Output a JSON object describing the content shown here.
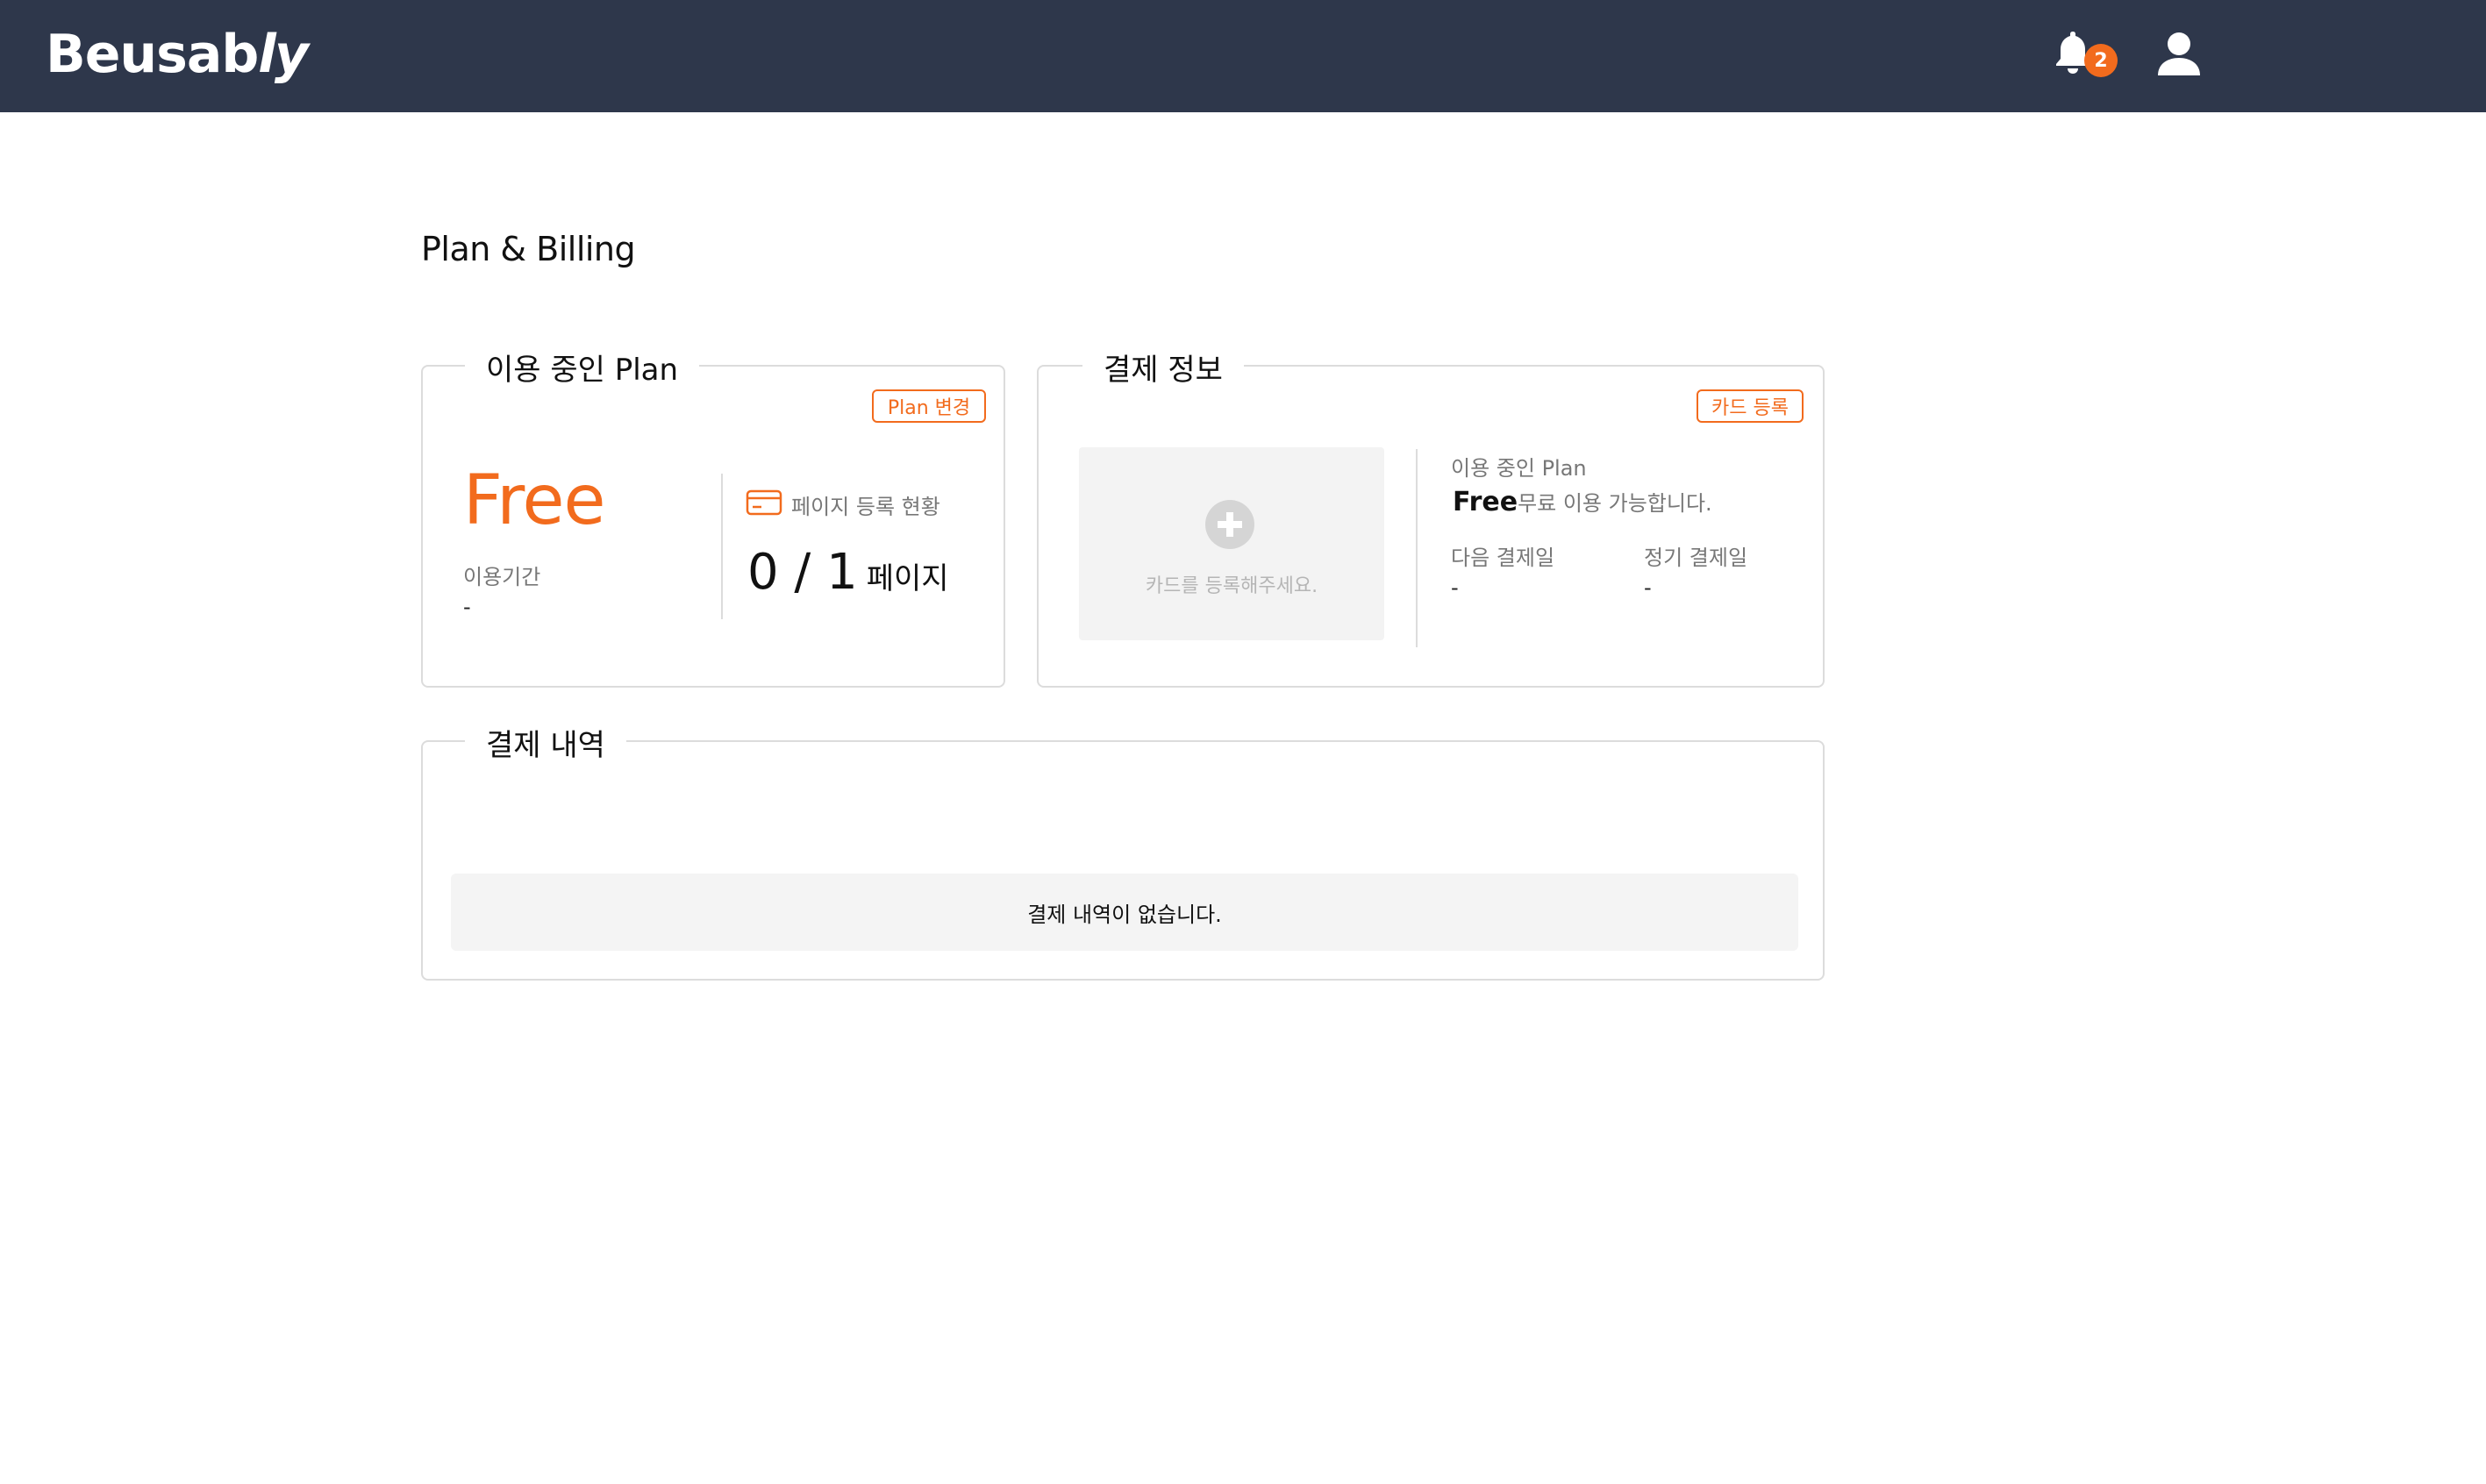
{
  "header": {
    "logo_main": "Beusab",
    "logo_suffix": "ly",
    "notification_count": "2"
  },
  "page": {
    "title": "Plan & Billing"
  },
  "plan_card": {
    "legend": "이용 중인 Plan",
    "change_button": "Plan 변경",
    "plan_name": "Free",
    "period_label": "이용기간",
    "period_value": "-",
    "page_status_label": "페이지 등록 현황",
    "page_count": "0 / 1",
    "page_unit": "페이지"
  },
  "billing_card": {
    "legend": "결제 정보",
    "register_card_button": "카드 등록",
    "add_card_hint": "카드를 등록해주세요.",
    "plan_label": "이용 중인 Plan",
    "plan_name": "Free",
    "plan_desc": "무료 이용 가능합니다.",
    "next_payment_label": "다음 결제일",
    "next_payment_value": "-",
    "regular_payment_label": "정기 결제일",
    "regular_payment_value": "-"
  },
  "history": {
    "legend": "결제 내역",
    "empty_message": "결제 내역이 없습니다."
  },
  "colors": {
    "header_bg": "#2e374b",
    "accent": "#f26b1d",
    "border": "#dcdcdc"
  }
}
